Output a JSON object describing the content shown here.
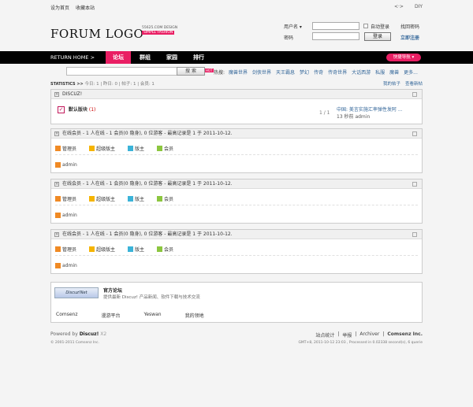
{
  "top": {
    "links": [
      "设为首页",
      "收藏本站"
    ],
    "right": [
      "<·>",
      "DIY"
    ]
  },
  "logo": {
    "text": "FORUM LOGO",
    "sub1": "55625.COM DESIGN",
    "sub2": "SIMPLE FASHION"
  },
  "login": {
    "user_label": "用户名",
    "pass_label": "密码",
    "remember": "自动登录",
    "forgot": "找回密码",
    "submit": "登录",
    "register": "立即注册"
  },
  "nav": {
    "return": "RETURN HOME >",
    "items": [
      "论坛",
      "群组",
      "家园",
      "排行"
    ],
    "quick": "快捷导航 ▾"
  },
  "search": {
    "select": "帖子",
    "button": "搜 索",
    "hot_badge": "HOT",
    "hot_label": "热搜:",
    "hot": [
      "魔兽世界",
      "剑侠世界",
      "天王霸息",
      "梦幻",
      "传奇",
      "传奇世界",
      "大话西游",
      "私服",
      "魔兽",
      "更多..."
    ]
  },
  "stats": {
    "label": "STATISTICS >>",
    "text": "今日: 1 | 昨日: 0 | 帖子: 1 | 会员: 1",
    "links": [
      "我的帖子",
      "查看新帖"
    ]
  },
  "discuz": {
    "title": "DISCUZ!",
    "forum": "默认版块",
    "count": "(1)",
    "pages": "1 / 1",
    "last_title": "中国: 美言实施汇率弹性发阿 ...",
    "last_time": "13 秒前 admin"
  },
  "online": {
    "text": "在线会员 - 1 人在线 - 1 会员(0 隐身), 0 位游客 - 最高记录是 1 于 2011-10-12.",
    "legend": [
      "管理员",
      "超级版主",
      "版主",
      "会员"
    ],
    "user": "admin"
  },
  "official": {
    "title": "官方论坛",
    "desc": "提供最新 Discuz! 产品新闻、软件下载与技术交流",
    "logo_text": "Discuz!Net",
    "links": [
      "Comsenz",
      "漫游平台",
      "Yeswan",
      "我的领地"
    ]
  },
  "footer": {
    "powered": "Powered by",
    "brand": "Discuz!",
    "ver": "X2",
    "copy": "© 2001-2011 Comsenz Inc.",
    "links": [
      "站点统计",
      "举报",
      "Archiver",
      "Comsenz Inc."
    ],
    "time": "GMT+8, 2011-10-12 23:03 , Processed in 0.02338 second(s), 6 querie"
  },
  "colors": {
    "accent": "#e91e63",
    "admin": "#f08a24",
    "supermod": "#f5b400",
    "mod": "#3bb3d8",
    "member": "#8cc63f"
  }
}
